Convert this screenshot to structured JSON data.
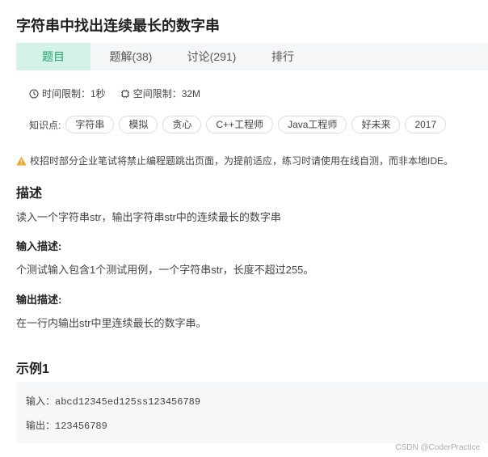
{
  "problem": {
    "title": "字符串中找出连续最长的数字串",
    "tabs": [
      {
        "label": "题目",
        "active": true
      },
      {
        "label": "题解(38)",
        "active": false
      },
      {
        "label": "讨论(291)",
        "active": false
      },
      {
        "label": "排行",
        "active": false
      }
    ],
    "time_limit": "时间限制：1秒",
    "space_limit": "空间限制：32M",
    "knowledge_label": "知识点:",
    "tags": [
      "字符串",
      "模拟",
      "贪心",
      "C++工程师",
      "Java工程师",
      "好未来",
      "2017"
    ],
    "warning": "校招时部分企业笔试将禁止编程题跳出页面，为提前适应，练习时请使用在线自测，而非本地IDE。",
    "description_heading": "描述",
    "description_text": "读入一个字符串str，输出字符串str中的连续最长的数字串",
    "input_heading": "输入描述:",
    "input_text": "个测试输入包含1个测试用例，一个字符串str，长度不超过255。",
    "output_heading": "输出描述:",
    "output_text": "在一行内输出str中里连续最长的数字串。",
    "example_heading": "示例1",
    "example_input_label": "输入：",
    "example_input_value": "abcd12345ed125ss123456789",
    "example_output_label": "输出：",
    "example_output_value": "123456789"
  },
  "watermark": "CSDN @CoderPractice",
  "colors": {
    "accent": "#22a66f",
    "active_tab_bg": "#d4f2e8",
    "warning_icon": "#f5a623"
  },
  "icons": {
    "time": "clock-icon",
    "space": "memory-chip-icon",
    "warning": "warning-triangle-icon"
  }
}
